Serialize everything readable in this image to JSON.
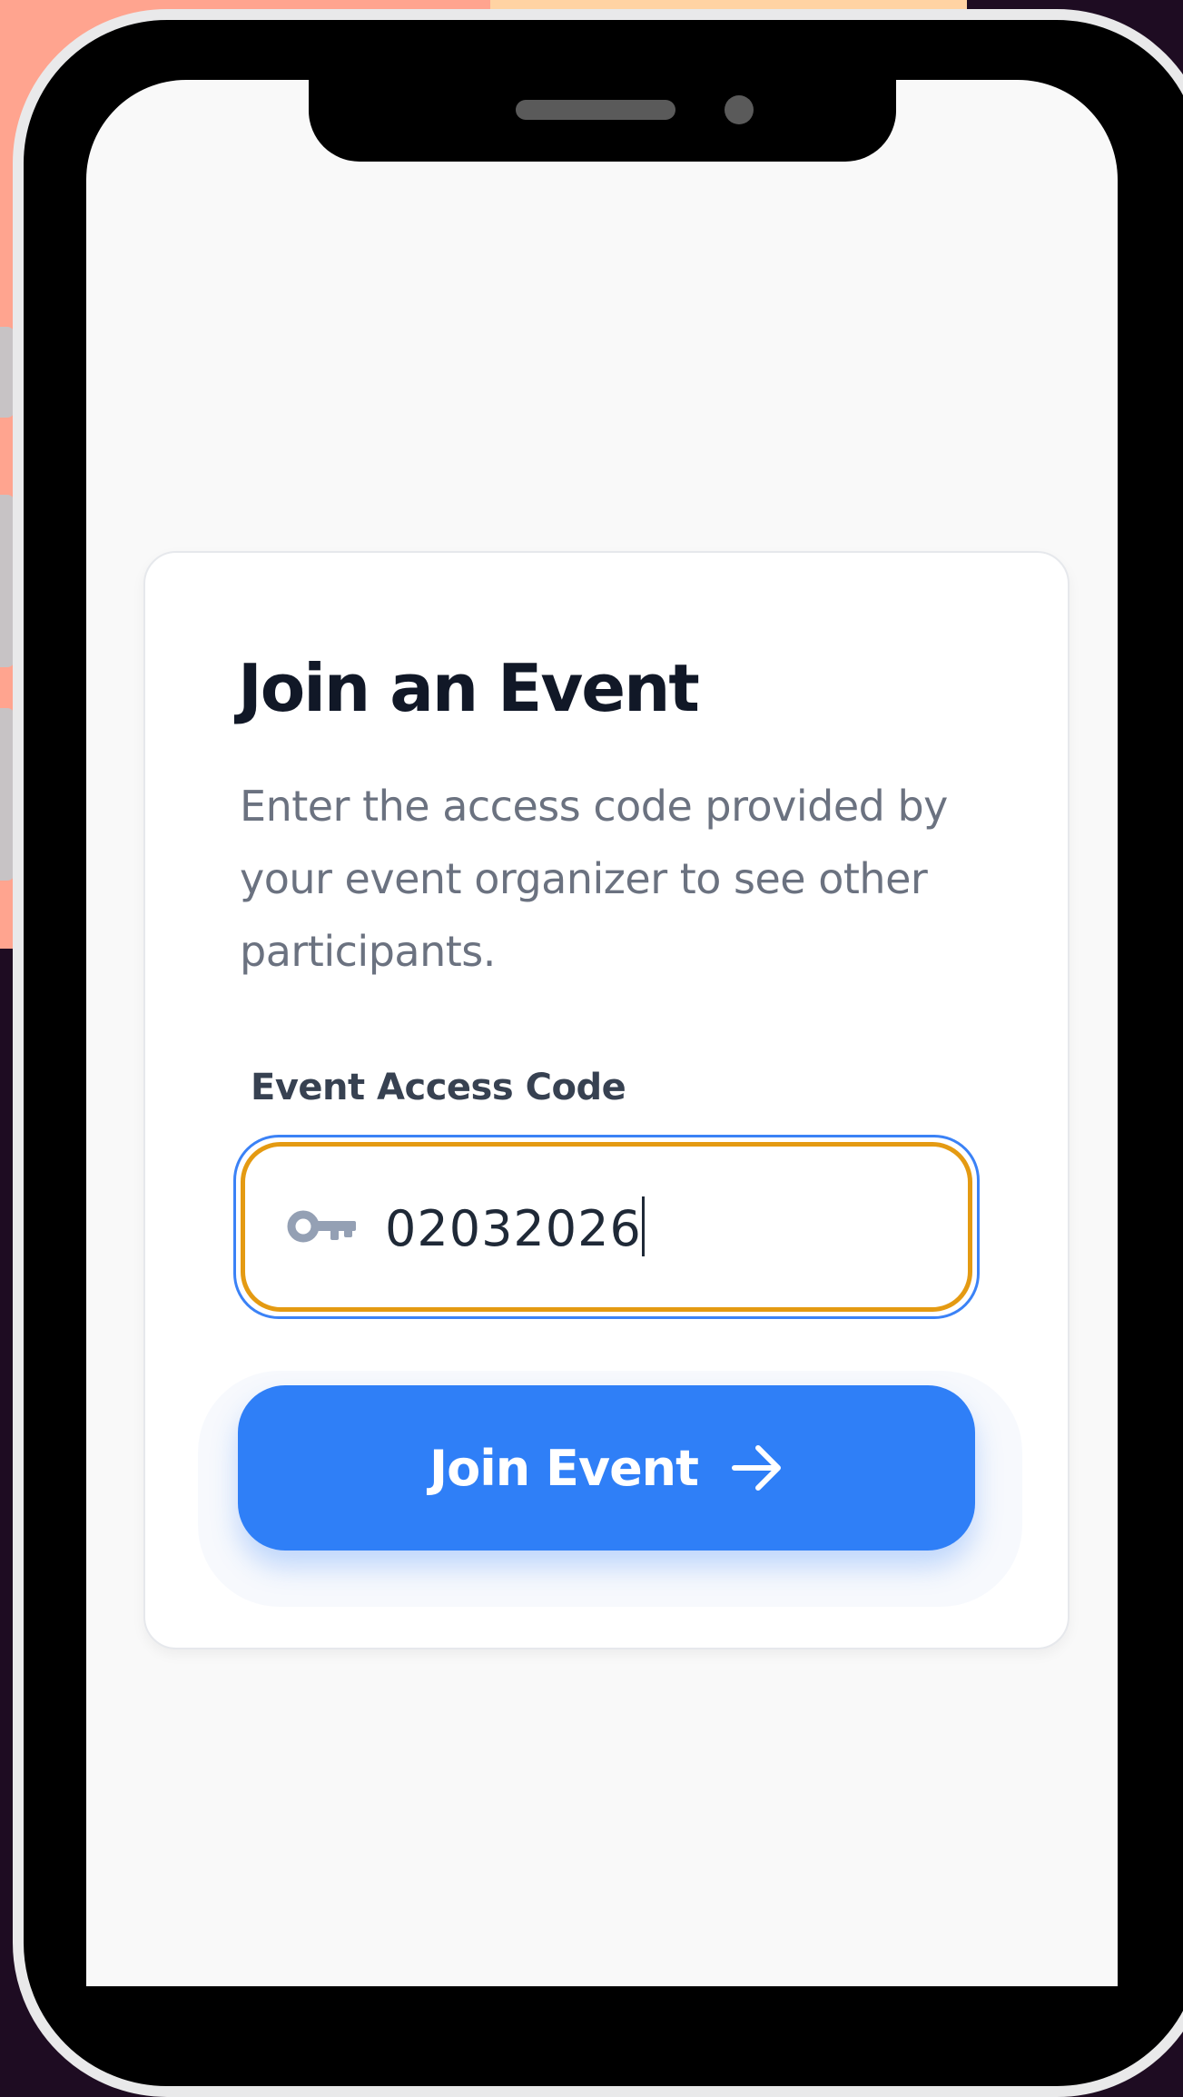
{
  "card": {
    "title": "Join an Event",
    "description": "Enter the access code provided by your event organizer to see other participants."
  },
  "form": {
    "label": "Event Access Code",
    "input_value": "02032026",
    "input_icon": "key-icon"
  },
  "button": {
    "label": "Join Event",
    "icon": "arrow-right-icon"
  },
  "colors": {
    "accent": "#2f7ff7",
    "focus_ring": "#e49a12",
    "focus_outline": "#3b82f6",
    "background_salmon": "#ffa48f",
    "background_dark": "#1e0c22"
  }
}
